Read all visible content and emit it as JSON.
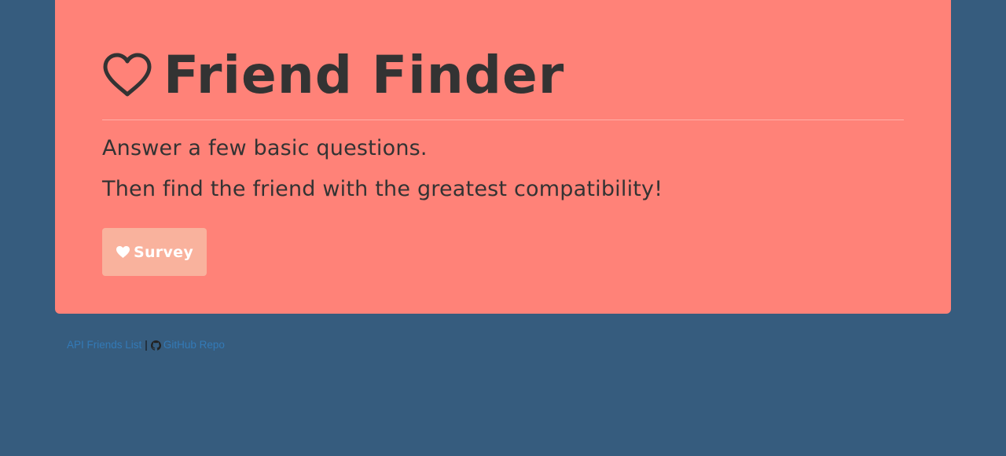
{
  "colors": {
    "page_background": "#365c7e",
    "hero_background": "#ff8278",
    "button_background": "#f9b29d",
    "text_dark": "#333333",
    "link": "#337ab7"
  },
  "hero": {
    "title_icon": "heart-outline-icon",
    "title": "Friend Finder",
    "line1": "Answer a few basic questions.",
    "line2": "Then find the friend with the greatest compatibility!",
    "survey_button": {
      "icon": "heart-icon",
      "label": "Survey"
    }
  },
  "footer": {
    "api_link": "API Friends List",
    "separator": "|",
    "repo_icon": "github-icon",
    "repo_link": "GitHub Repo"
  }
}
